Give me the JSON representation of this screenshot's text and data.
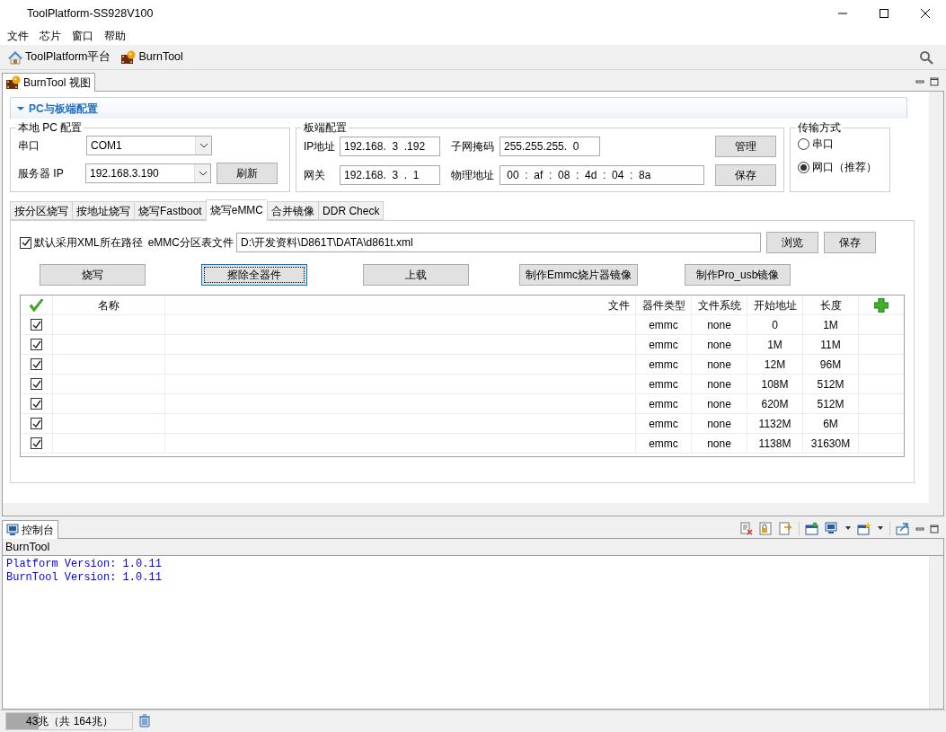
{
  "window": {
    "title": "ToolPlatform-SS928V100"
  },
  "menu": [
    "文件",
    "芯片",
    "窗口",
    "帮助"
  ],
  "toolbar": [
    {
      "label": "ToolPlatform平台",
      "kind": "home"
    },
    {
      "label": "BurnTool",
      "kind": "burn"
    }
  ],
  "view_tab": {
    "label": "BurnTool 视图",
    "selected": true
  },
  "section": {
    "title": "PC与板端配置",
    "expanded": true
  },
  "local_pc": {
    "title": "本地 PC 配置",
    "port_label": "串口",
    "port": "COM1",
    "server_label": "服务器 IP",
    "server": "192.168.3.190",
    "refresh": "刷新"
  },
  "board": {
    "title": "板端配置",
    "ip_label": "IP地址",
    "ip": "192.168.  3  .192",
    "gateway_label": "网关",
    "gateway": "192.168.  3  .  1",
    "mask_label": "子网掩码",
    "mask": "255.255.255.  0",
    "mac_label": "物理地址",
    "mac": " 00  :  af  :  08  :  4d  :  04  :  8a",
    "manage": "管理",
    "save": "保存"
  },
  "transfer": {
    "title": "传输方式",
    "options": [
      {
        "label": "串口",
        "selected": false
      },
      {
        "label": "网口（推荐）",
        "selected": true
      }
    ]
  },
  "tabs": [
    {
      "label": "按分区烧写",
      "selected": false
    },
    {
      "label": "按地址烧写",
      "selected": false
    },
    {
      "label": "烧写Fastboot",
      "selected": false
    },
    {
      "label": "烧写eMMC",
      "selected": true
    },
    {
      "label": "合并镜像",
      "selected": false
    },
    {
      "label": "DDR Check",
      "selected": false
    }
  ],
  "xml": {
    "default_path": {
      "label": "默认采用XML所在路径",
      "checked": true
    },
    "file_label": "eMMC分区表文件",
    "path": "D:\\开发资料\\D861T\\DATA\\d861t.xml",
    "browse": "浏览",
    "save": "保存"
  },
  "actions": [
    {
      "label": "烧写",
      "focused": false
    },
    {
      "label": "擦除全器件",
      "focused": true
    },
    {
      "label": "上载",
      "focused": false
    },
    {
      "label": "制作Emmc烧片器镜像",
      "focused": false
    },
    {
      "label": "制作Pro_usb镜像",
      "focused": false
    }
  ],
  "table": {
    "columns": [
      "名称",
      "文件",
      "器件类型",
      "文件系统",
      "开始地址",
      "长度"
    ],
    "rows": [
      {
        "checked": true,
        "device": "emmc",
        "fs": "none",
        "start": "0",
        "length": "1M"
      },
      {
        "checked": true,
        "device": "emmc",
        "fs": "none",
        "start": "1M",
        "length": "11M"
      },
      {
        "checked": true,
        "device": "emmc",
        "fs": "none",
        "start": "12M",
        "length": "96M"
      },
      {
        "checked": true,
        "device": "emmc",
        "fs": "none",
        "start": "108M",
        "length": "512M"
      },
      {
        "checked": true,
        "device": "emmc",
        "fs": "none",
        "start": "620M",
        "length": "512M"
      },
      {
        "checked": true,
        "device": "emmc",
        "fs": "none",
        "start": "1132M",
        "length": "6M"
      },
      {
        "checked": true,
        "device": "emmc",
        "fs": "none",
        "start": "1138M",
        "length": "31630M"
      }
    ]
  },
  "console": {
    "tab": "控制台",
    "name": "BurnTool",
    "lines": [
      "Platform Version: 1.0.11",
      "BurnTool Version: 1.0.11"
    ]
  },
  "status_bar": {
    "memory": "43兆（共 164兆）",
    "level": 0.26
  }
}
